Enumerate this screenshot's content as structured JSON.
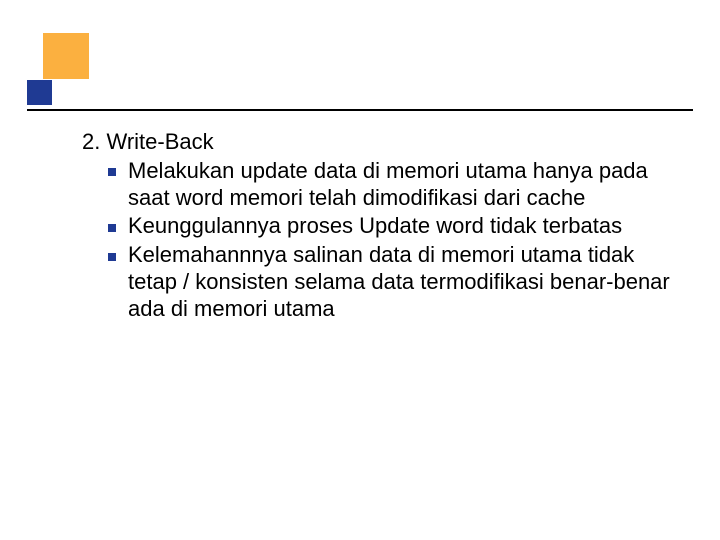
{
  "slide": {
    "heading": "2. Write-Back",
    "bullets": [
      "Melakukan update data di memori utama hanya pada saat word memori telah dimodifikasi dari cache",
      "Keunggulannya proses Update word tidak terbatas",
      "Kelemahannnya salinan data di memori utama tidak tetap / konsisten selama data termodifikasi benar-benar ada di memori utama"
    ]
  }
}
